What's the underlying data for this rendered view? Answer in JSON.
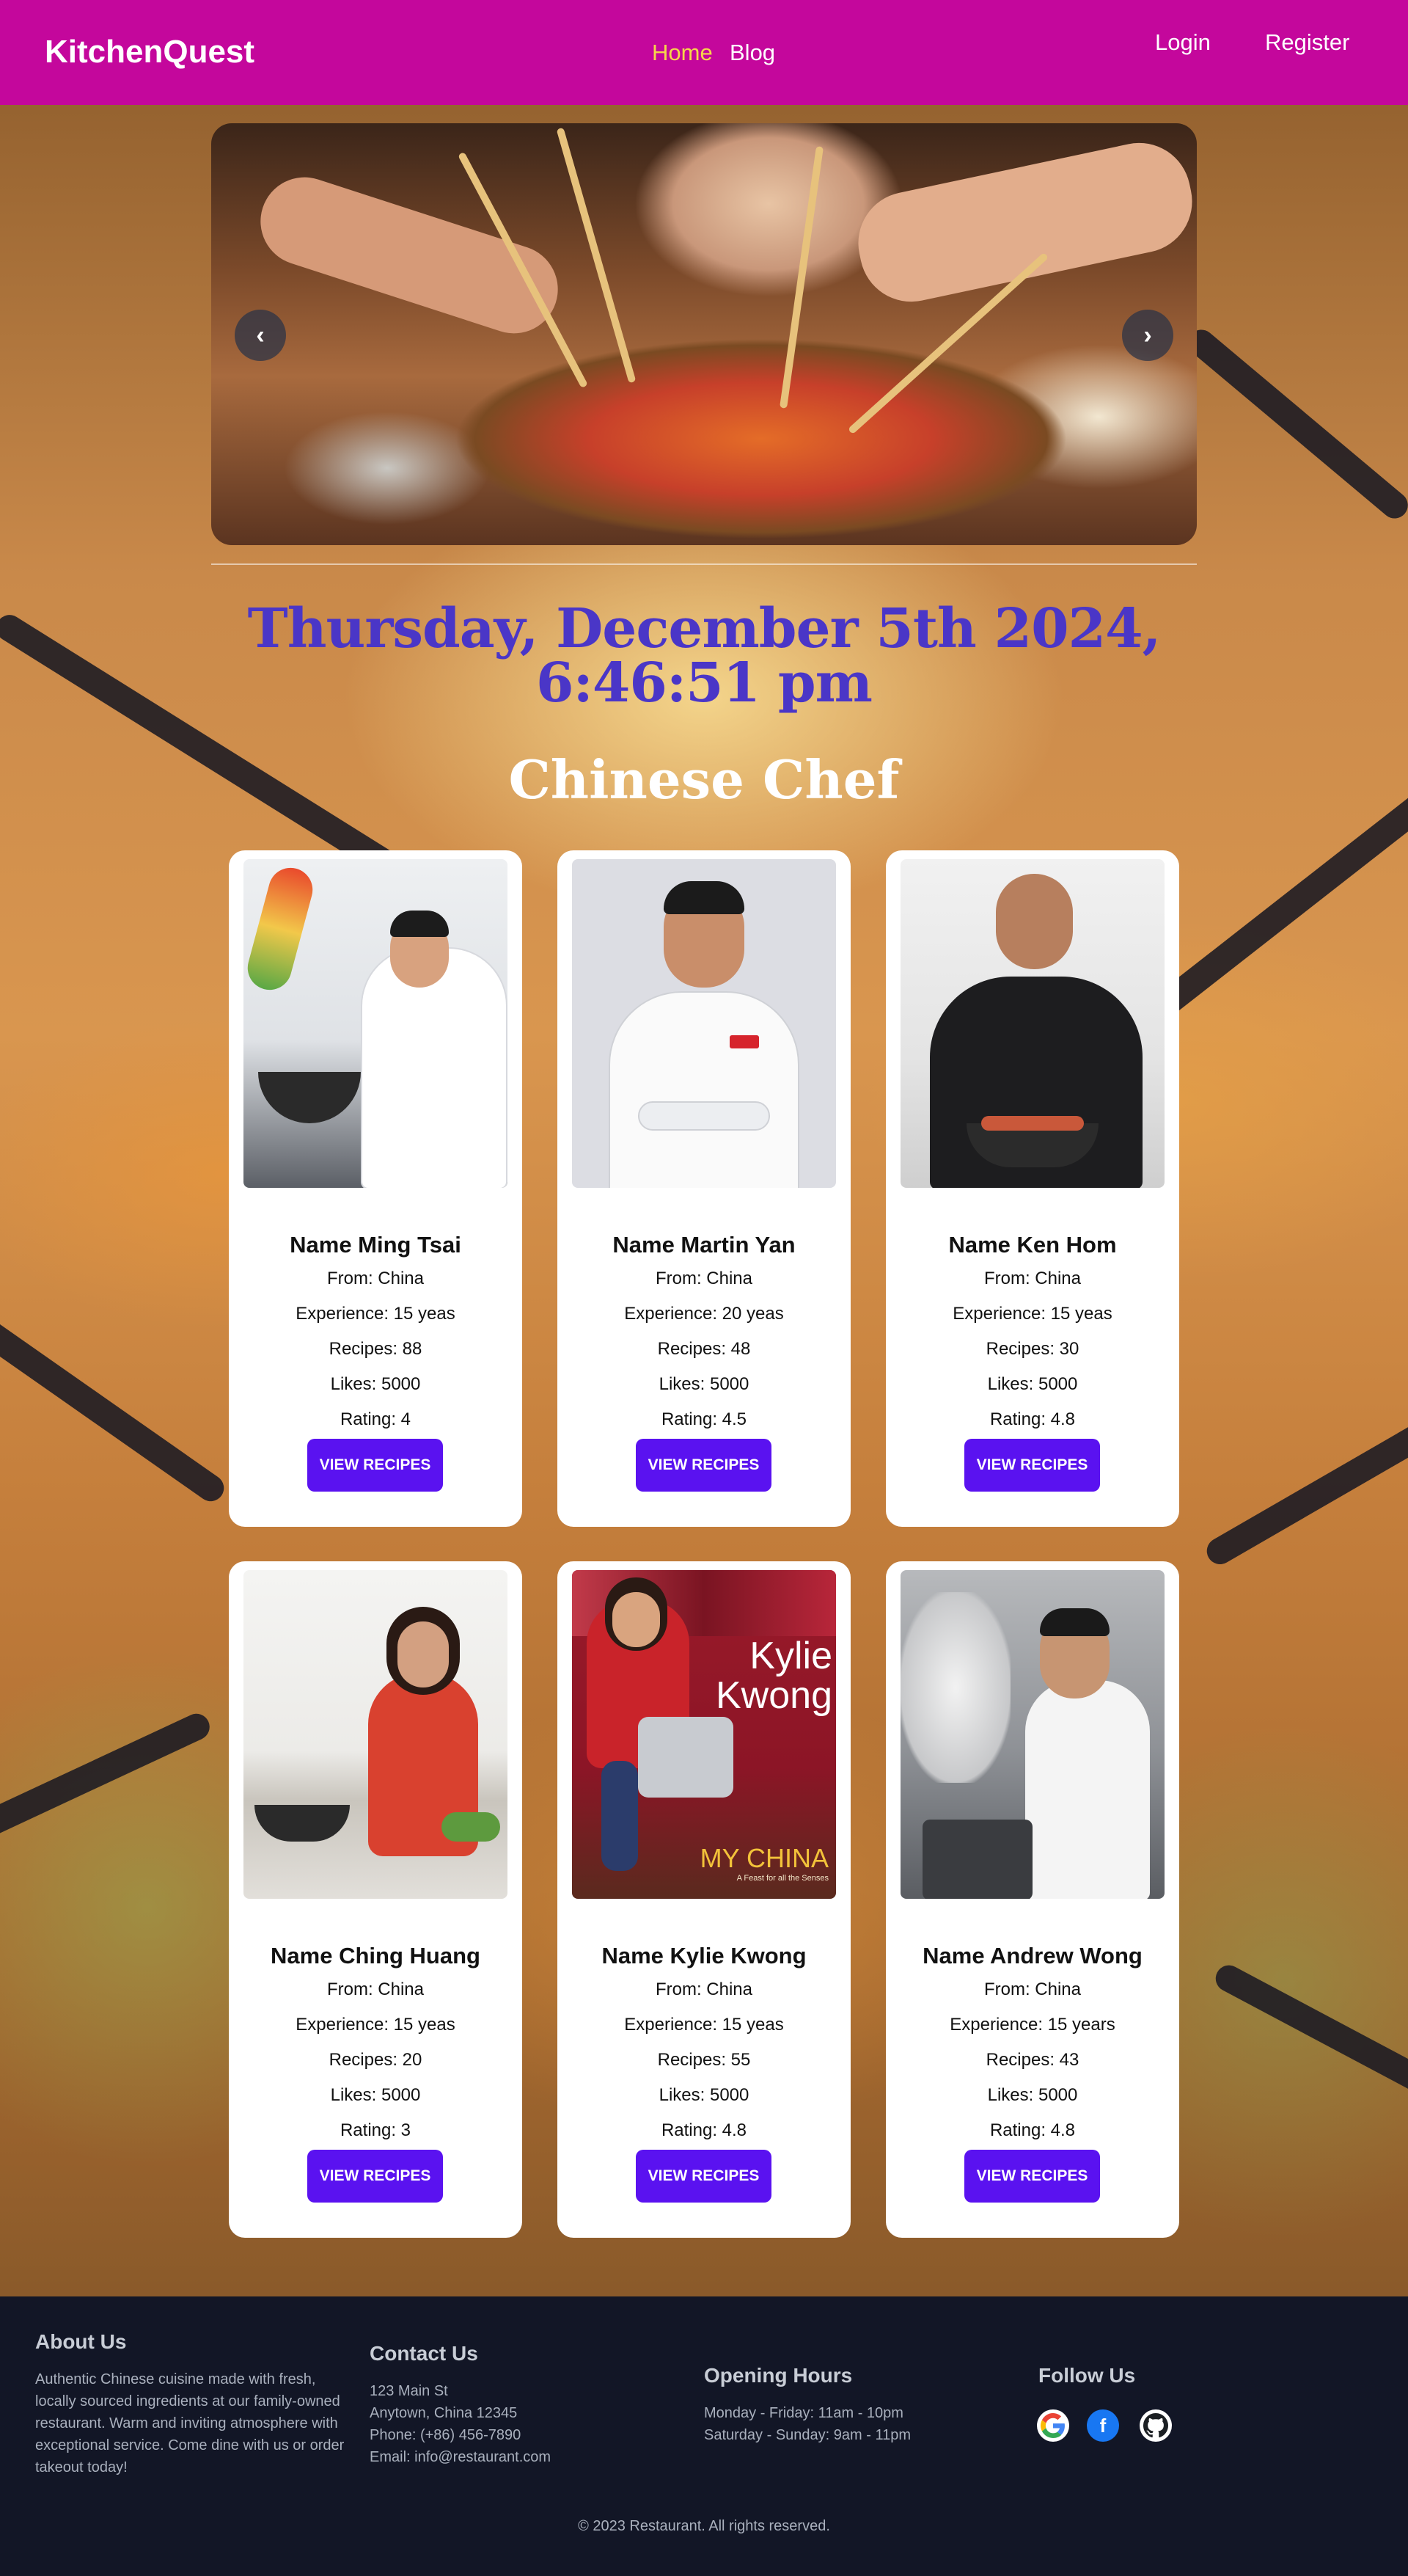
{
  "navbar": {
    "brand": "KitchenQuest",
    "links": [
      "Home",
      "Blog"
    ],
    "active_link": "Home",
    "login": "Login",
    "register": "Register",
    "background": "#c4079c"
  },
  "carousel": {
    "prev_icon": "chevron-left-icon",
    "next_icon": "chevron-right-icon",
    "prev_glyph": "‹",
    "next_glyph": "›"
  },
  "datetime": {
    "line1": "Thursday, December 5th 2024,",
    "line2": "6:46:51 pm",
    "color": "#4a36c7"
  },
  "section_title": "Chinese Chef",
  "cards": [
    {
      "name": "Name Ming Tsai",
      "from": "From: China",
      "experience": "Experience: 15 yeas",
      "recipes": "Recipes: 88",
      "likes": "Likes: 5000",
      "rating": "Rating: 4",
      "button": "VIEW RECIPES"
    },
    {
      "name": "Name Martin Yan",
      "from": "From: China",
      "experience": "Experience: 20 yeas",
      "recipes": "Recipes: 48",
      "likes": "Likes: 5000",
      "rating": "Rating: 4.5",
      "button": "VIEW RECIPES"
    },
    {
      "name": "Name Ken Hom",
      "from": "From: China",
      "experience": "Experience: 15 yeas",
      "recipes": "Recipes: 30",
      "likes": "Likes: 5000",
      "rating": "Rating: 4.8",
      "button": "VIEW RECIPES"
    },
    {
      "name": "Name Ching Huang",
      "from": "From: China",
      "experience": "Experience: 15 yeas",
      "recipes": "Recipes: 20",
      "likes": "Likes: 5000",
      "rating": "Rating: 3",
      "button": "VIEW RECIPES"
    },
    {
      "name": "Name Kylie Kwong",
      "from": "From: China",
      "experience": "Experience: 15 yeas",
      "recipes": "Recipes: 55",
      "likes": "Likes: 5000",
      "rating": "Rating: 4.8",
      "button": "VIEW RECIPES"
    },
    {
      "name": "Name Andrew Wong",
      "from": "From: China",
      "experience": "Experience: 15 years",
      "recipes": "Recipes: 43",
      "likes": "Likes: 5000",
      "rating": "Rating: 4.8",
      "button": "VIEW RECIPES"
    }
  ],
  "book_cover": {
    "title_line1": "Kylie",
    "title_line2": "Kwong",
    "subtitle": "MY CHINA",
    "tagline": "A Feast for all the Senses"
  },
  "footer": {
    "about": {
      "heading": "About Us",
      "lines": [
        "Authentic Chinese cuisine made with fresh,",
        "locally sourced ingredients at our family-owned",
        "restaurant. Warm and inviting atmosphere with",
        "exceptional service. Come dine with us or order",
        "takeout today!"
      ]
    },
    "contact": {
      "heading": "Contact Us",
      "lines": [
        "123 Main St",
        "Anytown, China 12345",
        "Phone: (+86) 456-7890",
        "Email: info@restaurant.com"
      ]
    },
    "hours": {
      "heading": "Opening Hours",
      "lines": [
        "Monday - Friday: 11am - 10pm",
        "Saturday - Sunday: 9am - 11pm"
      ]
    },
    "follow": {
      "heading": "Follow Us",
      "icons": [
        "google-icon",
        "facebook-icon",
        "github-icon"
      ]
    },
    "copyright": "© 2023 Restaurant. All rights reserved."
  },
  "colors": {
    "button": "#5a12f0",
    "footer_bg": "#121626",
    "active_link": "#f6d64a"
  }
}
